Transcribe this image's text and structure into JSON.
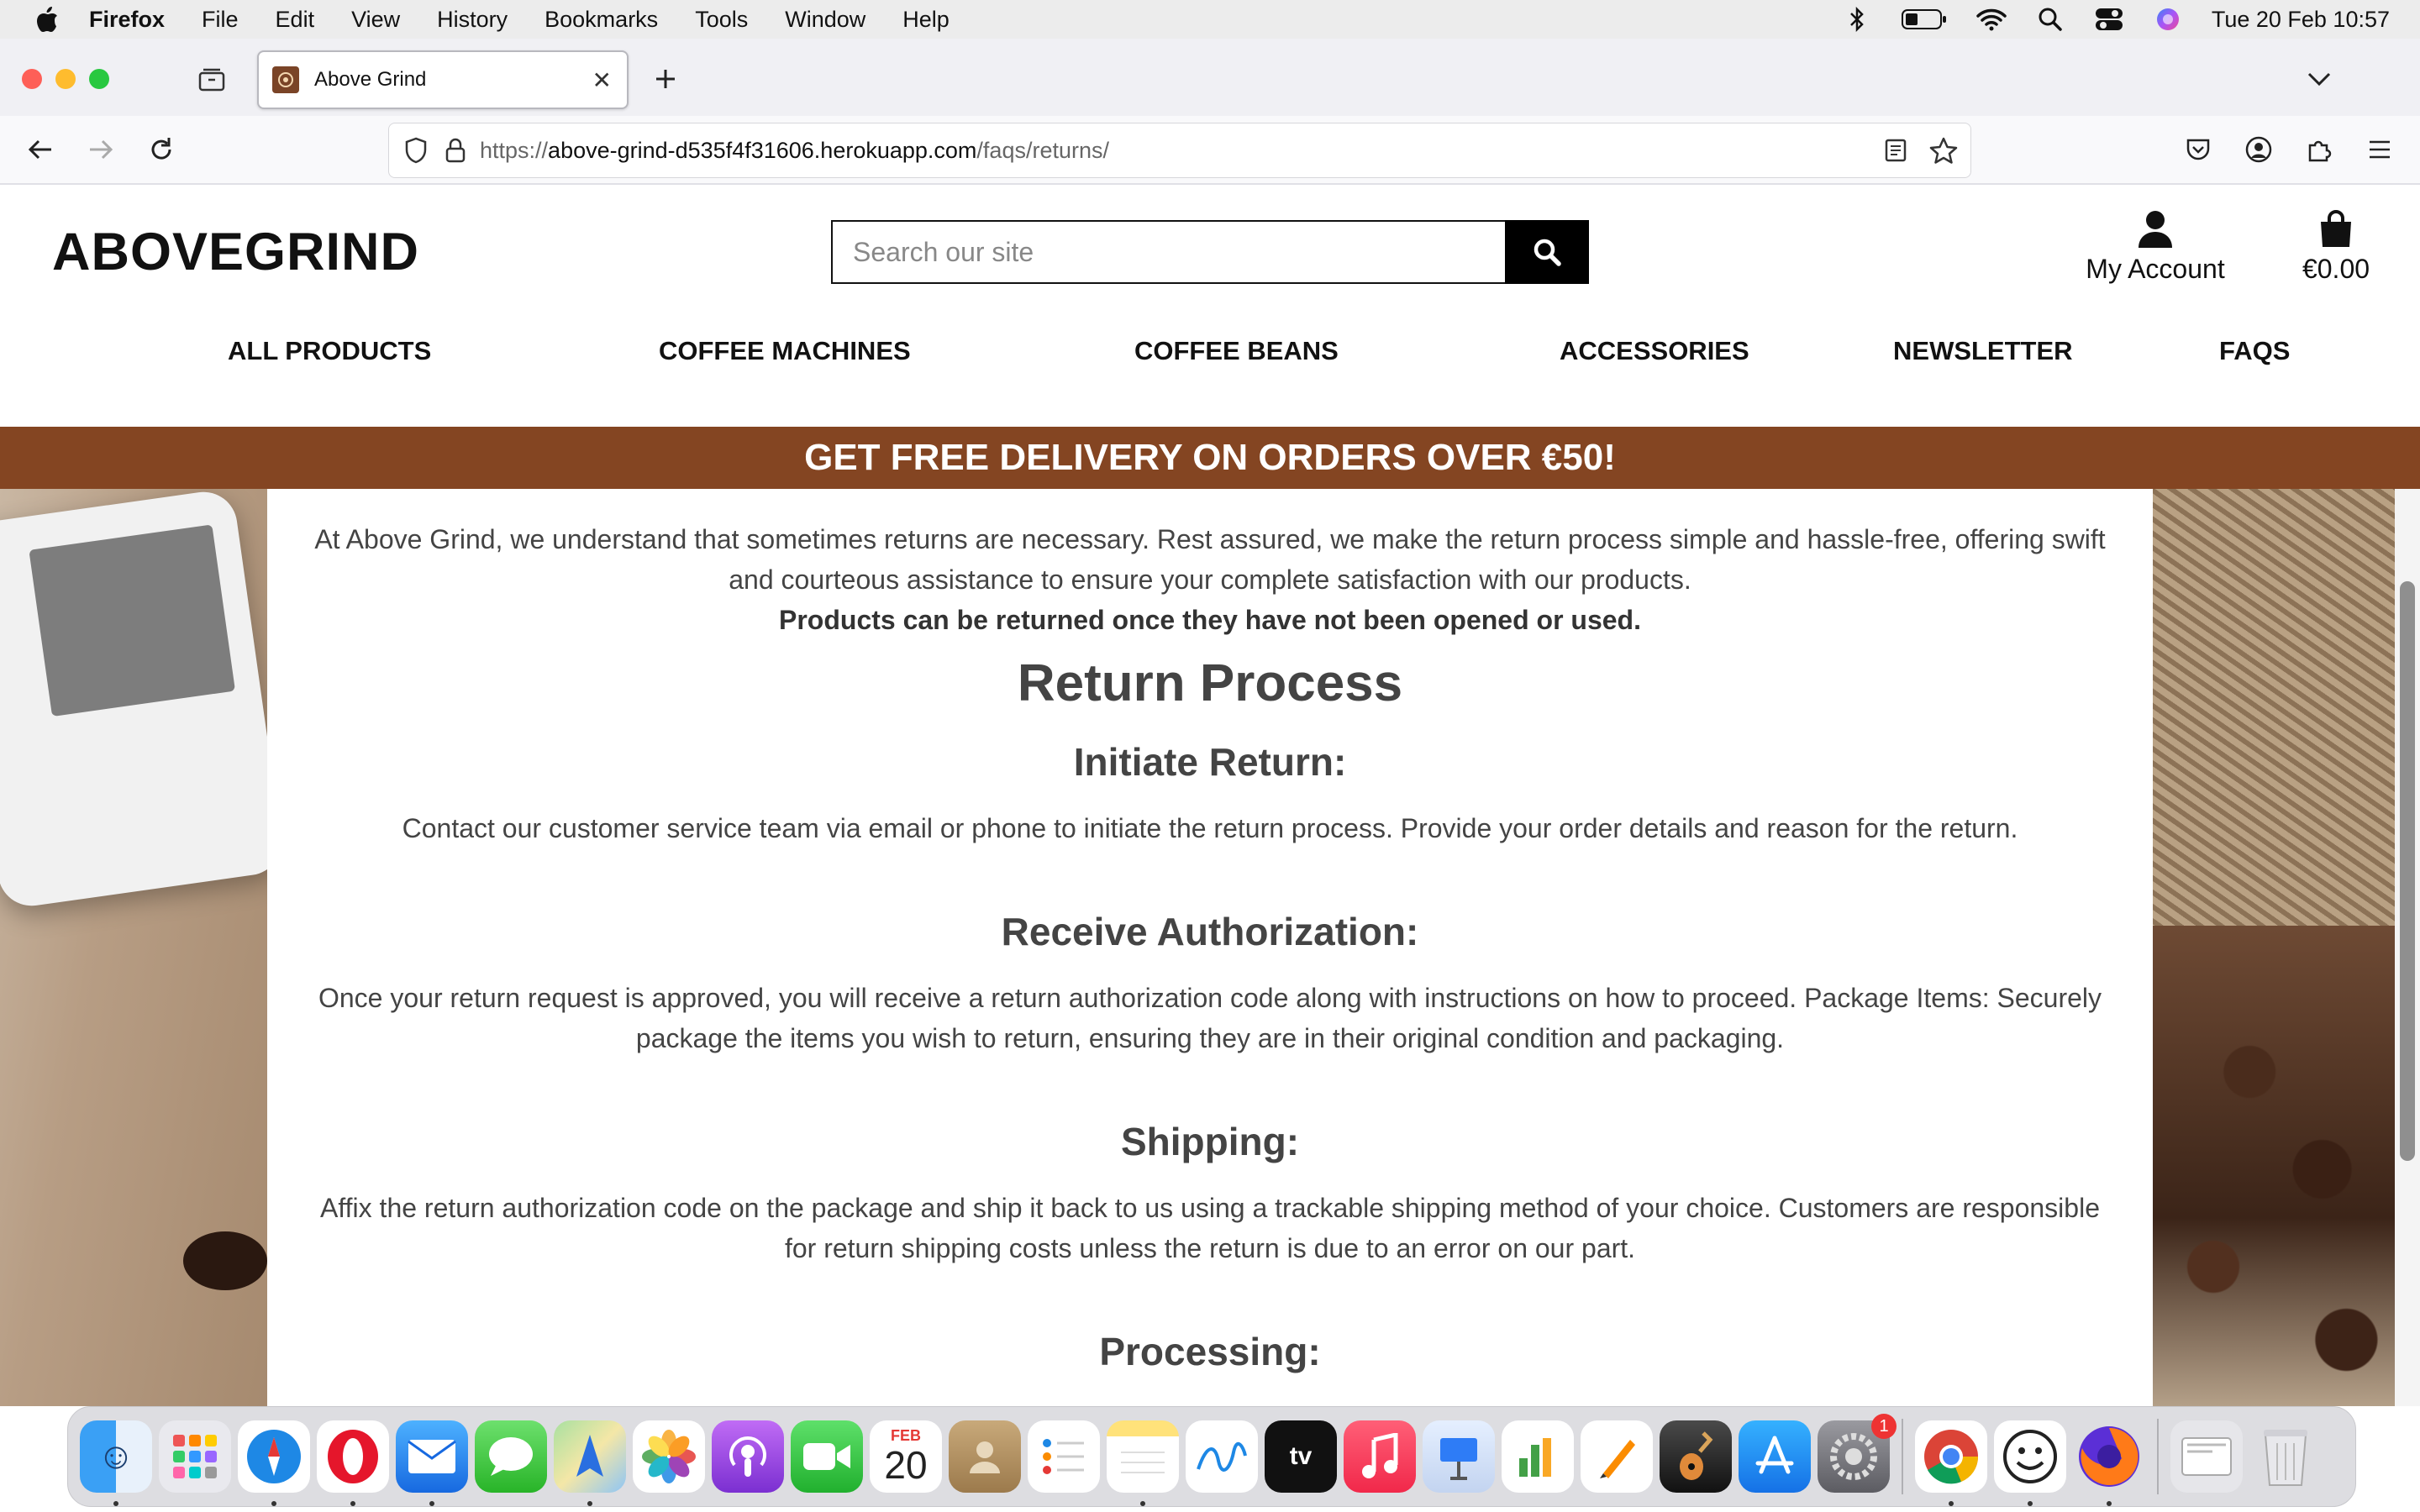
{
  "menubar": {
    "app": "Firefox",
    "items": [
      "File",
      "Edit",
      "View",
      "History",
      "Bookmarks",
      "Tools",
      "Window",
      "Help"
    ],
    "clock": "Tue 20 Feb  10:57"
  },
  "browser": {
    "tab_title": "Above Grind",
    "url_prefix": "https://",
    "url_host": "above-grind-d535f4f31606.herokuapp.com",
    "url_path": "/faqs/returns/"
  },
  "site": {
    "logo": "ABOVEGRIND",
    "search_placeholder": "Search our site",
    "account_label": "My Account",
    "cart_total": "€0.00",
    "nav": [
      "ALL PRODUCTS",
      "COFFEE MACHINES",
      "COFFEE BEANS",
      "ACCESSORIES",
      "NEWSLETTER",
      "FAQS"
    ],
    "banner": "GET FREE DELIVERY ON ORDERS OVER €50!"
  },
  "content": {
    "intro_line1": "At Above Grind, we understand that sometimes returns are necessary. Rest assured, we make the return process simple and hassle-free, offering swift",
    "intro_line2": "and courteous assistance to ensure your complete satisfaction with our products.",
    "intro_bold": "Products can be returned once they have not been opened or used.",
    "heading": "Return Process",
    "sections": [
      {
        "title": "Initiate Return:",
        "lines": [
          "Contact our customer service team via email or phone to initiate the return process. Provide your order details and reason for the return."
        ]
      },
      {
        "title": "Receive Authorization:",
        "lines": [
          "Once your return request is approved, you will receive a return authorization code along with instructions on how to proceed. Package Items: Securely",
          "package the items you wish to return, ensuring they are in their original condition and packaging."
        ]
      },
      {
        "title": "Shipping:",
        "lines": [
          "Affix the return authorization code on the package and ship it back to us using a trackable shipping method of your choice. Customers are responsible",
          "for return shipping costs unless the return is due to an error on our part."
        ]
      },
      {
        "title": "Processing:",
        "lines": []
      }
    ]
  },
  "dock": {
    "calendar_month": "FEB",
    "calendar_day": "20",
    "settings_badge": "1",
    "apps": [
      "finder",
      "launchpad",
      "safari",
      "opera",
      "mail",
      "messages",
      "maps",
      "photos",
      "podcasts",
      "facetime",
      "calendar",
      "contacts",
      "reminders",
      "notes",
      "freeform",
      "tv",
      "music",
      "keynote",
      "numbers",
      "pages",
      "garageband",
      "app-store",
      "system-settings",
      "chrome",
      "smiley",
      "firefox",
      "downloads",
      "trash"
    ]
  }
}
